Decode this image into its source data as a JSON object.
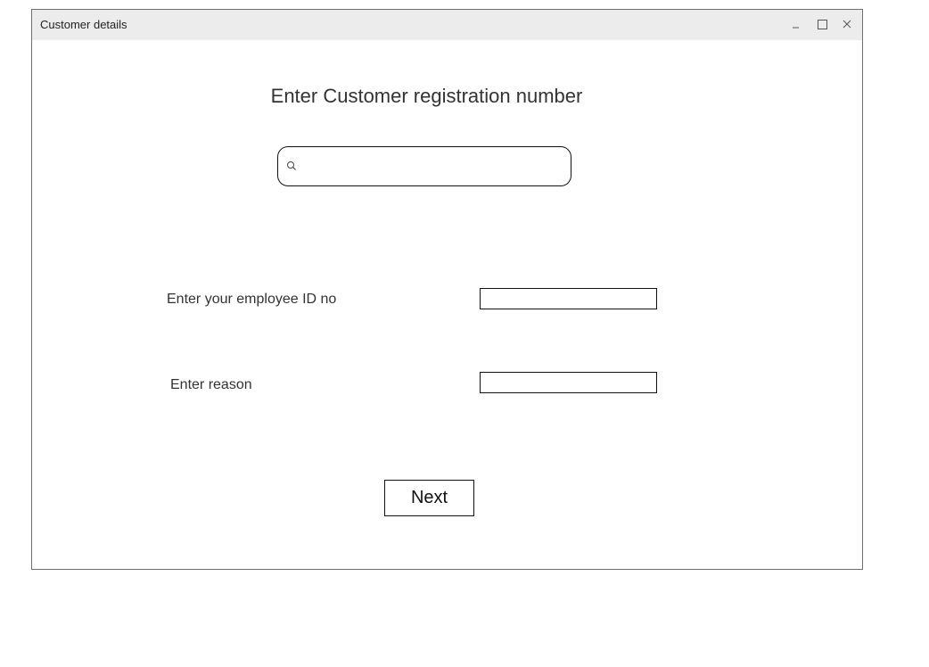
{
  "window": {
    "title": "Customer details",
    "controls": [
      "minimize-icon",
      "maximize-icon",
      "close-icon"
    ]
  },
  "main": {
    "heading": "Enter Customer registration number",
    "search": {
      "value": "",
      "placeholder": "",
      "icon": "search-icon"
    },
    "employee_id": {
      "label": "Enter your employee ID no",
      "value": ""
    },
    "reason": {
      "label": "Enter reason",
      "value": ""
    },
    "next_label": "Next"
  },
  "colors": {
    "titlebar": "#ececec",
    "border": "#111111",
    "window_border": "#6e6e6e"
  }
}
